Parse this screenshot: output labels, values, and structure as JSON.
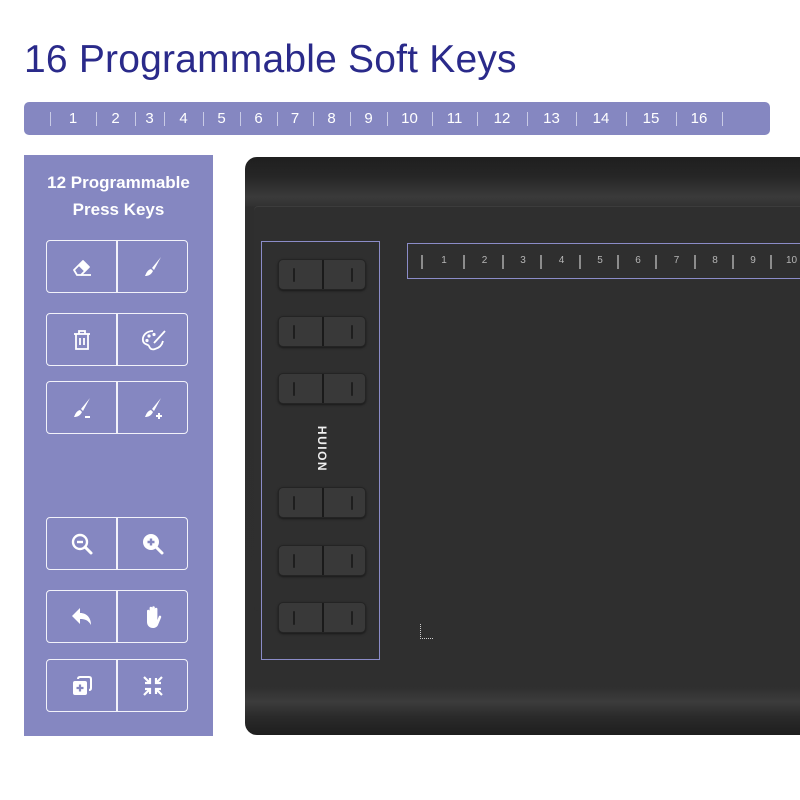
{
  "title": "16 Programmable Soft Keys",
  "soft_keys": [
    "1",
    "2",
    "3",
    "4",
    "5",
    "6",
    "7",
    "8",
    "9",
    "10",
    "11",
    "12",
    "13",
    "14",
    "15",
    "16"
  ],
  "press_keys_panel": {
    "title_line1": "12 Programmable",
    "title_line2": "Press Keys",
    "pairs": [
      [
        {
          "icon": "eraser-icon",
          "label": "Eraser"
        },
        {
          "icon": "brush-icon",
          "label": "Brush"
        }
      ],
      [
        {
          "icon": "trash-icon",
          "label": "Delete"
        },
        {
          "icon": "palette-icon",
          "label": "Palette"
        }
      ],
      [
        {
          "icon": "brush-smaller-icon",
          "label": "Brush size down"
        },
        {
          "icon": "brush-larger-icon",
          "label": "Brush size up"
        }
      ],
      [
        {
          "icon": "zoom-out-icon",
          "label": "Zoom out"
        },
        {
          "icon": "zoom-in-icon",
          "label": "Zoom in"
        }
      ],
      [
        {
          "icon": "undo-icon",
          "label": "Undo"
        },
        {
          "icon": "hand-icon",
          "label": "Pan"
        }
      ],
      [
        {
          "icon": "new-layer-icon",
          "label": "New layer"
        },
        {
          "icon": "fit-screen-icon",
          "label": "Fit to screen"
        }
      ]
    ]
  },
  "tablet": {
    "brand": "HUION",
    "soft_keys_visible": [
      "1",
      "2",
      "3",
      "4",
      "5",
      "6",
      "7",
      "8",
      "9",
      "10"
    ],
    "hardware_key_rows": 6
  },
  "colors": {
    "title": "#2a2a8a",
    "panel": "#8587c1",
    "tablet": "#2f2f2f",
    "frame": "#8b8cc8"
  }
}
